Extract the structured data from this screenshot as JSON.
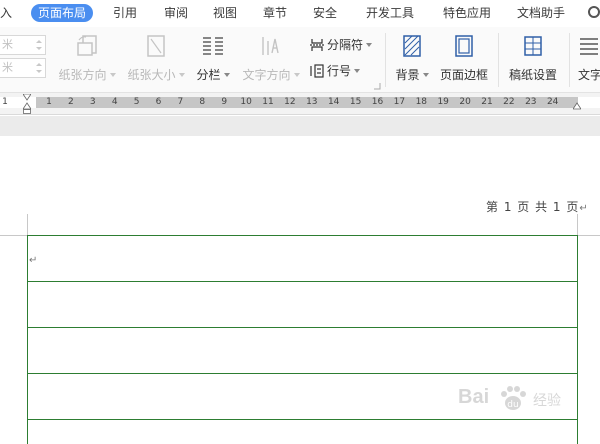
{
  "menu": {
    "tabs": [
      {
        "label": "入",
        "active": false
      },
      {
        "label": "页面布局",
        "active": true
      },
      {
        "label": "引用",
        "active": false
      },
      {
        "label": "审阅",
        "active": false
      },
      {
        "label": "视图",
        "active": false
      },
      {
        "label": "章节",
        "active": false
      },
      {
        "label": "安全",
        "active": false
      },
      {
        "label": "开发工具",
        "active": false
      },
      {
        "label": "特色应用",
        "active": false
      },
      {
        "label": "文档助手",
        "active": false
      }
    ],
    "search_icon": "search-icon"
  },
  "ribbon": {
    "spin_top_value": "米",
    "spin_bottom_value": "米",
    "orientation_label": "纸张方向",
    "size_label": "纸张大小",
    "columns_label": "分栏",
    "text_direction_label": "文字方向",
    "separator_label": "分隔符",
    "line_number_label": "行号",
    "background_label": "背景",
    "page_border_label": "页面边框",
    "manuscript_label": "稿纸设置",
    "text_wrap_label": "文字"
  },
  "ruler": {
    "numbers": [
      "1",
      "1",
      "2",
      "3",
      "4",
      "5",
      "6",
      "7",
      "8",
      "9",
      "10",
      "11",
      "12",
      "13",
      "14",
      "15",
      "16",
      "17",
      "18",
      "19",
      "20",
      "21",
      "22",
      "23",
      "24"
    ]
  },
  "document": {
    "header_text": "第 1 页 共 1 页",
    "header_mark": "↵",
    "paragraph_mark": "↵",
    "grid_color": "#2d7d32"
  },
  "watermark": {
    "brand": "Bai",
    "brand_end": "经验",
    "icon": "paw-icon"
  },
  "colors": {
    "accent": "#4a8ef0"
  }
}
